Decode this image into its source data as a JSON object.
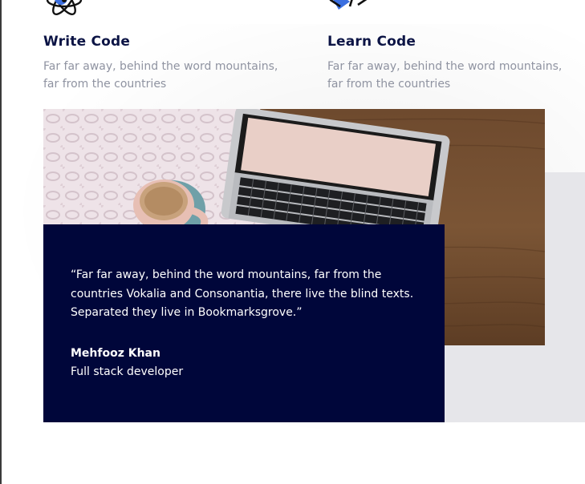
{
  "features": [
    {
      "title": "Write Code",
      "description": "Far far away, behind the word mountains, far from the countries",
      "icon": "atom-icon"
    },
    {
      "title": "Learn Code",
      "description": "Far far away, behind the word mountains, far from the countries",
      "icon": "code-brackets-icon"
    }
  ],
  "testimonial": {
    "quote": "“Far far away, behind the word mountains, far from the countries Vokalia and Consonantia, there live the blind texts. Separated they live in Bookmarksgrove.”",
    "author": "Mehfooz Khan",
    "role": "Full stack developer"
  },
  "colors": {
    "heading": "#0c1445",
    "body_text": "#8f93a1",
    "quote_background": "#00063a",
    "accent_blue": "#3b6fe0",
    "side_block": "#e6e6ea"
  }
}
